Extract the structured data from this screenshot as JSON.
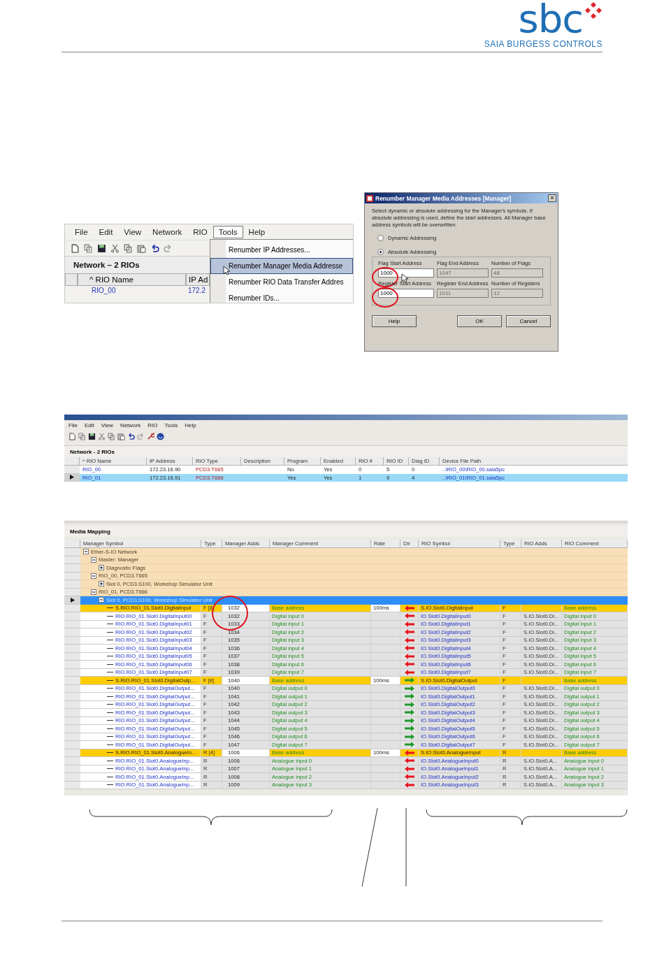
{
  "header": {
    "brand": "sbc",
    "company": "SAIA BURGESS CONTROLS"
  },
  "menu_figure": {
    "menu": [
      {
        "label": "File",
        "selected": false
      },
      {
        "label": "Edit",
        "selected": false
      },
      {
        "label": "View",
        "selected": false
      },
      {
        "label": "Network",
        "selected": false
      },
      {
        "label": "RIO",
        "selected": false
      },
      {
        "label": "Tools",
        "selected": true
      },
      {
        "label": "Help",
        "selected": false
      }
    ],
    "panel_title": "Network – 2 RIOs",
    "columns": [
      "^ RIO Name",
      "IP Ad"
    ],
    "row": [
      "RIO_00",
      "172.2"
    ],
    "dropdown": [
      {
        "label": "Renumber IP Addresses...",
        "selected": false
      },
      {
        "label": "Renumber Manager Media Addresse",
        "selected": true
      },
      {
        "label": "Renumber RIO Data Transfer Addres",
        "selected": false
      },
      {
        "label": "Renumber IDs...",
        "selected": false
      }
    ]
  },
  "dialog": {
    "title": "Renumber Manager Media Addresses [Manager]",
    "close": "×",
    "description": "Select dynamic or absolute addressing for the Manager's symbols. If absolute addressing is used, define the start addresses. All Manager base address symbols will be overwritten.",
    "radios": [
      {
        "label": "Dynamic Addressing",
        "selected": false
      },
      {
        "label": "Absolute Addressing",
        "selected": true
      }
    ],
    "fields": [
      {
        "label": "Flag Start Address",
        "value": "1000",
        "disabled": false
      },
      {
        "label": "Flag End Address",
        "value": "1047",
        "disabled": true
      },
      {
        "label": "Number of Flags",
        "value": "48",
        "disabled": true
      },
      {
        "label": "Register Start Address",
        "value": "1000",
        "disabled": false
      },
      {
        "label": "Register End Address",
        "value": "1011",
        "disabled": true
      },
      {
        "label": "Number of Registers",
        "value": "12",
        "disabled": true
      }
    ],
    "buttons": [
      "Help",
      "OK",
      "Cancel"
    ]
  },
  "app": {
    "menu": [
      "File",
      "Edit",
      "View",
      "Network",
      "RIO",
      "Tools",
      "Help"
    ],
    "network": {
      "title": "Network - 2 RIOs",
      "columns": [
        "^ RIO Name",
        "IP Address",
        "RIO Type",
        "Description",
        "Program",
        "Enabled",
        "RIO #",
        "RIO ID",
        "Diag ID",
        "Device File Path"
      ],
      "rows": [
        {
          "selected": false,
          "name": "RIO_00",
          "ip": "172.23.16.90",
          "type": "PCD3.T665",
          "program": "No",
          "enabled": "Yes",
          "rio_no": "0",
          "rio_id": "5",
          "diag_id": "0",
          "path": "..\\RIO_00\\RIO_00.saia5pc"
        },
        {
          "selected": true,
          "name": "RIO_01",
          "ip": "172.23.16.91",
          "type": "PCD3.T666",
          "program": "Yes",
          "enabled": "Yes",
          "rio_no": "1",
          "rio_id": "9",
          "diag_id": "4",
          "path": "..\\RIO_01\\RIO_01.saia5pc"
        }
      ]
    },
    "media": {
      "title": "Media Mapping",
      "columns": [
        "Manager Symbol",
        "Type",
        "Manager Adds",
        "Manager Comment",
        "Rate",
        "Dir",
        "RIO Symbol",
        "Type",
        "RIO Adds",
        "RIO Comment"
      ],
      "tree": [
        {
          "label": "Ether-S-IO Network",
          "expanded": true,
          "selected": false,
          "children": [
            {
              "label": "Master: Manager",
              "expanded": true,
              "selected": false,
              "children": [
                {
                  "label": "Diagnostic Flags",
                  "expanded": false,
                  "selected": false
                }
              ]
            },
            {
              "label": "RIO_00, PCD3.T665",
              "expanded": true,
              "selected": false,
              "children": [
                {
                  "label": "Slot 0, PCD3.S100, Workshop Simulator Unit",
                  "expanded": false,
                  "selected": false
                }
              ]
            },
            {
              "label": "RIO_01, PCD3.T666",
              "expanded": true,
              "selected": false,
              "children": [
                {
                  "label": "Slot 0, PCD3.S100, Workshop Simulator Unit",
                  "expanded": true,
                  "selected": true,
                  "children": [
                    {
                      "kind": "base",
                      "symbol": "S.RIO.RIO_01.Slot0.DigitalInput",
                      "type": "F [8]",
                      "adds": "1032",
                      "comment": "Base address",
                      "rate": "100ms",
                      "inbound": true,
                      "rio_symbol": "S.IO.Slot0.DigitalInput",
                      "rio_type": "F",
                      "rio_comment": "Base address"
                    },
                    {
                      "kind": "item",
                      "symbol": "RIO.RIO_01.Slot0.DigitalInput00",
                      "type": "F",
                      "adds": "1032",
                      "comment": "Digital input 0",
                      "inbound": true,
                      "rio_symbol": "IO.Slot0.DigitalInput0",
                      "rio_type": "F",
                      "rio_adds": "S.IO.Slot0.Di...",
                      "rio_comment": "Digital input 0"
                    },
                    {
                      "kind": "item",
                      "symbol": "RIO.RIO_01.Slot0.DigitalInput01",
                      "type": "F",
                      "adds": "1033",
                      "comment": "Digital input 1",
                      "inbound": true,
                      "rio_symbol": "IO.Slot0.DigitalInput1",
                      "rio_type": "F",
                      "rio_adds": "S.IO.Slot0.Di...",
                      "rio_comment": "Digital input 1"
                    },
                    {
                      "kind": "item",
                      "symbol": "RIO.RIO_01.Slot0.DigitalInput02",
                      "type": "F",
                      "adds": "1034",
                      "comment": "Digital input 2",
                      "inbound": true,
                      "rio_symbol": "IO.Slot0.DigitalInput2",
                      "rio_type": "F",
                      "rio_adds": "S.IO.Slot0.Di...",
                      "rio_comment": "Digital input 2"
                    },
                    {
                      "kind": "item",
                      "symbol": "RIO.RIO_01.Slot0.DigitalInput03",
                      "type": "F",
                      "adds": "1035",
                      "comment": "Digital input 3",
                      "inbound": true,
                      "rio_symbol": "IO.Slot0.DigitalInput3",
                      "rio_type": "F",
                      "rio_adds": "S.IO.Slot0.Di...",
                      "rio_comment": "Digital input 3"
                    },
                    {
                      "kind": "item",
                      "symbol": "RIO.RIO_01.Slot0.DigitalInput04",
                      "type": "F",
                      "adds": "1036",
                      "comment": "Digital input 4",
                      "inbound": true,
                      "rio_symbol": "IO.Slot0.DigitalInput4",
                      "rio_type": "F",
                      "rio_adds": "S.IO.Slot0.Di...",
                      "rio_comment": "Digital input 4"
                    },
                    {
                      "kind": "item",
                      "symbol": "RIO.RIO_01.Slot0.DigitalInput05",
                      "type": "F",
                      "adds": "1037",
                      "comment": "Digital input 5",
                      "inbound": true,
                      "rio_symbol": "IO.Slot0.DigitalInput5",
                      "rio_type": "F",
                      "rio_adds": "S.IO.Slot0.Di...",
                      "rio_comment": "Digital input 5"
                    },
                    {
                      "kind": "item",
                      "symbol": "RIO.RIO_01.Slot0.DigitalInput06",
                      "type": "F",
                      "adds": "1038",
                      "comment": "Digital input 6",
                      "inbound": true,
                      "rio_symbol": "IO.Slot0.DigitalInput6",
                      "rio_type": "F",
                      "rio_adds": "S.IO.Slot0.Di...",
                      "rio_comment": "Digital input 6"
                    },
                    {
                      "kind": "item",
                      "symbol": "RIO.RIO_01.Slot0.DigitalInput07",
                      "type": "F",
                      "adds": "1039",
                      "comment": "Digital input 7",
                      "inbound": true,
                      "rio_symbol": "IO.Slot0.DigitalInput7",
                      "rio_type": "F",
                      "rio_adds": "S.IO.Slot0.Di...",
                      "rio_comment": "Digital input 7"
                    },
                    {
                      "kind": "base",
                      "symbol": "S.RIO.RIO_01.Slot0.DigitalOutp...",
                      "type": "F [8]",
                      "adds": "1040",
                      "comment": "Base address",
                      "rate": "100ms",
                      "inbound": false,
                      "rio_symbol": "S.IO.Slot0.DigitalOutput",
                      "rio_type": "F",
                      "rio_comment": "Base address"
                    },
                    {
                      "kind": "item",
                      "symbol": "RIO.RIO_01.Slot0.DigitalOutput...",
                      "type": "F",
                      "adds": "1040",
                      "comment": "Digital output 0",
                      "inbound": false,
                      "rio_symbol": "IO.Slot0.DigitalOutput0",
                      "rio_type": "F",
                      "rio_adds": "S.IO.Slot0.Di...",
                      "rio_comment": "Digital output 0"
                    },
                    {
                      "kind": "item",
                      "symbol": "RIO.RIO_01.Slot0.DigitalOutput...",
                      "type": "F",
                      "adds": "1041",
                      "comment": "Digital output 1",
                      "inbound": false,
                      "rio_symbol": "IO.Slot0.DigitalOutput1",
                      "rio_type": "F",
                      "rio_adds": "S.IO.Slot0.Di...",
                      "rio_comment": "Digital output 1"
                    },
                    {
                      "kind": "item",
                      "symbol": "RIO.RIO_01.Slot0.DigitalOutput...",
                      "type": "F",
                      "adds": "1042",
                      "comment": "Digital output 2",
                      "inbound": false,
                      "rio_symbol": "IO.Slot0.DigitalOutput2",
                      "rio_type": "F",
                      "rio_adds": "S.IO.Slot0.Di...",
                      "rio_comment": "Digital output 2"
                    },
                    {
                      "kind": "item",
                      "symbol": "RIO.RIO_01.Slot0.DigitalOutput...",
                      "type": "F",
                      "adds": "1043",
                      "comment": "Digital output 3",
                      "inbound": false,
                      "rio_symbol": "IO.Slot0.DigitalOutput3",
                      "rio_type": "F",
                      "rio_adds": "S.IO.Slot0.Di...",
                      "rio_comment": "Digital output 3"
                    },
                    {
                      "kind": "item",
                      "symbol": "RIO.RIO_01.Slot0.DigitalOutput...",
                      "type": "F",
                      "adds": "1044",
                      "comment": "Digital output 4",
                      "inbound": false,
                      "rio_symbol": "IO.Slot0.DigitalOutput4",
                      "rio_type": "F",
                      "rio_adds": "S.IO.Slot0.Di...",
                      "rio_comment": "Digital output 4"
                    },
                    {
                      "kind": "item",
                      "symbol": "RIO.RIO_01.Slot0.DigitalOutput...",
                      "type": "F",
                      "adds": "1045",
                      "comment": "Digital output 5",
                      "inbound": false,
                      "rio_symbol": "IO.Slot0.DigitalOutput5",
                      "rio_type": "F",
                      "rio_adds": "S.IO.Slot0.Di...",
                      "rio_comment": "Digital output 5"
                    },
                    {
                      "kind": "item",
                      "symbol": "RIO.RIO_01.Slot0.DigitalOutput...",
                      "type": "F",
                      "adds": "1046",
                      "comment": "Digital output 6",
                      "inbound": false,
                      "rio_symbol": "IO.Slot0.DigitalOutput6",
                      "rio_type": "F",
                      "rio_adds": "S.IO.Slot0.Di...",
                      "rio_comment": "Digital output 6"
                    },
                    {
                      "kind": "item",
                      "symbol": "RIO.RIO_01.Slot0.DigitalOutput...",
                      "type": "F",
                      "adds": "1047",
                      "comment": "Digital output 7",
                      "inbound": false,
                      "rio_symbol": "IO.Slot0.DigitalOutput7",
                      "rio_type": "F",
                      "rio_adds": "S.IO.Slot0.Di...",
                      "rio_comment": "Digital output 7"
                    },
                    {
                      "kind": "base",
                      "symbol": "S.RIO.RIO_01.Slot0.AnalogueIn...",
                      "type": "R [4]",
                      "adds": "1006",
                      "comment": "Base address",
                      "rate": "100ms",
                      "inbound": true,
                      "rio_symbol": "S.IO.Slot0.AnalogueInput",
                      "rio_type": "R",
                      "rio_comment": "Base address"
                    },
                    {
                      "kind": "item",
                      "symbol": "RIO.RIO_01.Slot0.AnalogueInp...",
                      "type": "R",
                      "adds": "1006",
                      "comment": "Analogue input 0",
                      "inbound": true,
                      "rio_symbol": "IO.Slot0.AnalogueInput0",
                      "rio_type": "R",
                      "rio_adds": "S.IO.Slot0.A...",
                      "rio_comment": "Analogue input 0"
                    },
                    {
                      "kind": "item",
                      "symbol": "RIO.RIO_01.Slot0.AnalogueInp...",
                      "type": "R",
                      "adds": "1007",
                      "comment": "Analogue input 1",
                      "inbound": true,
                      "rio_symbol": "IO.Slot0.AnalogueInput1",
                      "rio_type": "R",
                      "rio_adds": "S.IO.Slot0.A...",
                      "rio_comment": "Analogue input 1"
                    },
                    {
                      "kind": "item",
                      "symbol": "RIO.RIO_01.Slot0.AnalogueInp...",
                      "type": "R",
                      "adds": "1008",
                      "comment": "Analogue input 2",
                      "inbound": true,
                      "rio_symbol": "IO.Slot0.AnalogueInput2",
                      "rio_type": "R",
                      "rio_adds": "S.IO.Slot0.A...",
                      "rio_comment": "Analogue input 2"
                    },
                    {
                      "kind": "item",
                      "symbol": "RIO.RIO_01.Slot0.AnalogueInp...",
                      "type": "R",
                      "adds": "1009",
                      "comment": "Analogue input 3",
                      "inbound": true,
                      "rio_symbol": "IO.Slot0.AnalogueInput3",
                      "rio_type": "R",
                      "rio_adds": "S.IO.Slot0.A...",
                      "rio_comment": "Analogue input 3"
                    }
                  ]
                }
              ]
            }
          ]
        }
      ]
    }
  }
}
